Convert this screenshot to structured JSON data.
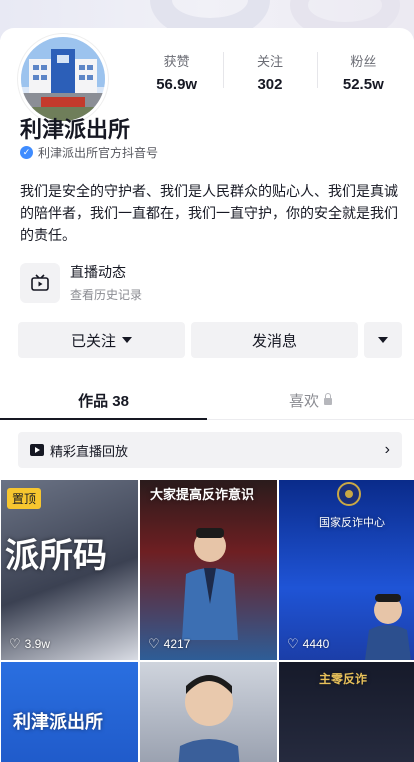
{
  "profile": {
    "name": "利津派出所",
    "verify_text": "利津派出所官方抖音号",
    "bio": "我们是安全的守护者、我们是人民群众的贴心人、我们是真诚的陪伴者，我们一直都在，我们一直守护，你的安全就是我们的责任。"
  },
  "stats": [
    {
      "label": "获赞",
      "value": "56.9w"
    },
    {
      "label": "关注",
      "value": "302"
    },
    {
      "label": "粉丝",
      "value": "52.5w"
    }
  ],
  "live": {
    "title": "直播动态",
    "subtitle": "查看历史记录"
  },
  "actions": {
    "follow": "已关注",
    "message": "发消息"
  },
  "tabs": [
    {
      "label": "作品 38"
    },
    {
      "label": "喜欢"
    }
  ],
  "replay": {
    "label": "精彩直播回放"
  },
  "videos": [
    {
      "pinned": "置顶",
      "likes": "3.9w",
      "overlay": "派所码"
    },
    {
      "likes": "4217",
      "overlay": "大家提高反诈意识"
    },
    {
      "likes": "4440",
      "overlay": "国家反诈中心"
    },
    {
      "overlay": "利津派出所"
    },
    {},
    {
      "overlay": "主零反诈"
    }
  ],
  "colors": {
    "accent": "#161823",
    "pin": "#f7c62f",
    "verify": "#3f8cff",
    "button_bg": "#f2f2f4"
  }
}
